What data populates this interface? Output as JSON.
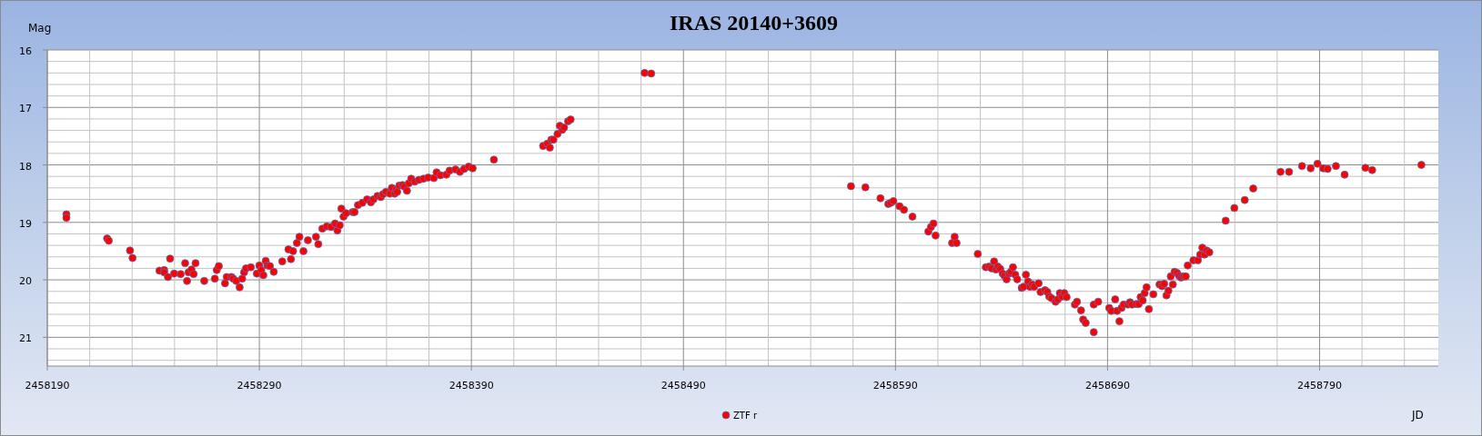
{
  "chart": {
    "chart_data": {
      "type": "scatter",
      "title": "IRAS 20140+3609",
      "xlabel": "JD",
      "ylabel": "Mag",
      "xlim": [
        2458190,
        2458846
      ],
      "ylim": [
        21.5,
        16
      ],
      "xticks": [
        2458190,
        2458290,
        2458390,
        2458490,
        2458590,
        2458690,
        2458790
      ],
      "yticks": [
        16,
        17,
        18,
        19,
        20,
        21
      ],
      "grid": true,
      "x": [
        2458199.0,
        2458199.0,
        2458218.2,
        2458219.0,
        2458229.0,
        2458230.2,
        2458242.9,
        2458245.1,
        2458245.1,
        2458246.9,
        2458247.9,
        2458249.8,
        2458252.9,
        2458255.0,
        2458255.9,
        2458256.6,
        2458258.0,
        2458259.0,
        2458259.9,
        2458264.0,
        2458269.0,
        2458269.9,
        2458270.9,
        2458273.8,
        2458274.6,
        2458276.9,
        2458277.7,
        2458279.1,
        2458280.7,
        2458281.9,
        2458282.8,
        2458283.7,
        2458286.0,
        2458288.8,
        2458290.0,
        2458290.9,
        2458291.9,
        2458293.0,
        2458293.8,
        2458295.0,
        2458296.8,
        2458300.8,
        2458303.7,
        2458304.9,
        2458305.9,
        2458307.7,
        2458308.9,
        2458310.8,
        2458312.9,
        2458316.7,
        2458317.8,
        2458319.7,
        2458321.8,
        2458323.8,
        2458325.7,
        2458326.8,
        2458327.9,
        2458328.7,
        2458329.7,
        2458330.9,
        2458334.0,
        2458334.9,
        2458336.5,
        2458338.6,
        2458340.8,
        2458342.6,
        2458343.8,
        2458345.7,
        2458347.3,
        2458348.3,
        2458349.7,
        2458351.6,
        2458352.5,
        2458353.8,
        2458354.4,
        2458355.0,
        2458356.0,
        2458357.5,
        2458358.4,
        2458359.6,
        2458360.5,
        2458361.6,
        2458363.3,
        2458365.3,
        2458367.4,
        2458369.6,
        2458372.3,
        2458373.6,
        2458375.4,
        2458378.2,
        2458379.7,
        2458382.5,
        2458384.6,
        2458386.6,
        2458388.7,
        2458390.6,
        2458400.6,
        2458423.8,
        2458425.8,
        2458427.0,
        2458427.7,
        2458428.7,
        2458430.6,
        2458431.7,
        2458432.8,
        2458433.7,
        2458435.6,
        2458436.8,
        2458471.7,
        2458474.8,
        2458569.0,
        2458575.8,
        2458582.9,
        2458586.6,
        2458587.8,
        2458589.0,
        2458591.9,
        2458594.0,
        2458598.0,
        2458605.5,
        2458606.7,
        2458607.9,
        2458608.9,
        2458616.7,
        2458617.9,
        2458618.8,
        2458628.8,
        2458632.6,
        2458634.1,
        2458635.3,
        2458636.5,
        2458637.4,
        2458638.3,
        2458639.4,
        2458640.5,
        2458641.4,
        2458642.4,
        2458643.5,
        2458644.4,
        2458645.4,
        2458646.5,
        2458647.4,
        2458649.5,
        2458650.4,
        2458651.5,
        2458652.5,
        2458653.4,
        2458654.5,
        2458655.4,
        2458657.5,
        2458658.4,
        2458660.5,
        2458661.6,
        2458662.5,
        2458663.6,
        2458665.5,
        2458666.6,
        2458667.5,
        2458668.5,
        2458669.6,
        2458670.7,
        2458674.6,
        2458675.6,
        2458677.5,
        2458678.5,
        2458679.7,
        2458683.5,
        2458683.5,
        2458685.6,
        2458690.8,
        2458691.8,
        2458693.6,
        2458694.5,
        2458695.6,
        2458696.6,
        2458697.6,
        2458699.7,
        2458700.6,
        2458701.6,
        2458703.6,
        2458704.7,
        2458705.6,
        2458706.6,
        2458707.5,
        2458708.4,
        2458709.5,
        2458711.6,
        2458714.5,
        2458715.7,
        2458716.7,
        2458717.8,
        2458718.7,
        2458719.8,
        2458720.8,
        2458721.6,
        2458722.8,
        2458723.7,
        2458724.7,
        2458725.8,
        2458726.9,
        2458727.8,
        2458730.5,
        2458732.6,
        2458733.7,
        2458734.7,
        2458735.8,
        2458736.8,
        2458738.0,
        2458745.7,
        2458749.8,
        2458754.7,
        2458758.7,
        2458771.6,
        2458775.6,
        2458781.7,
        2458785.8,
        2458789.0,
        2458791.7,
        2458793.8,
        2458797.7,
        2458801.8,
        2458811.6,
        2458814.8,
        2458838.0
      ],
      "series": [
        {
          "name": "ZTF r",
          "color": "#ff0000",
          "values": [
            18.86,
            18.92,
            19.28,
            19.32,
            19.49,
            19.62,
            19.84,
            19.83,
            19.87,
            19.95,
            19.63,
            19.89,
            19.9,
            19.71,
            20.02,
            19.87,
            19.82,
            19.9,
            19.71,
            20.02,
            19.98,
            19.83,
            19.76,
            20.06,
            19.95,
            19.95,
            19.98,
            20.02,
            20.13,
            19.98,
            19.87,
            19.8,
            19.78,
            19.89,
            19.75,
            19.83,
            19.92,
            19.67,
            19.75,
            19.76,
            19.86,
            19.68,
            19.47,
            19.64,
            19.5,
            19.36,
            19.25,
            19.5,
            19.31,
            19.25,
            19.38,
            19.11,
            19.07,
            19.08,
            19.02,
            19.14,
            19.05,
            18.76,
            18.9,
            18.84,
            18.82,
            18.82,
            18.7,
            18.66,
            18.6,
            18.65,
            18.6,
            18.54,
            18.56,
            18.51,
            18.47,
            18.5,
            18.4,
            18.5,
            18.43,
            18.47,
            18.36,
            18.35,
            18.38,
            18.45,
            18.32,
            18.24,
            18.29,
            18.26,
            18.24,
            18.22,
            18.23,
            18.13,
            18.18,
            18.17,
            18.1,
            18.08,
            18.12,
            18.07,
            18.03,
            18.06,
            17.91,
            17.67,
            17.63,
            17.7,
            17.56,
            17.56,
            17.46,
            17.32,
            17.39,
            17.35,
            17.24,
            17.21,
            16.4,
            16.41,
            18.37,
            18.39,
            18.58,
            18.68,
            18.66,
            18.63,
            18.72,
            18.78,
            18.9,
            19.16,
            19.08,
            19.02,
            19.23,
            19.36,
            19.25,
            19.36,
            19.55,
            19.78,
            19.77,
            19.8,
            19.68,
            19.82,
            19.77,
            19.81,
            19.89,
            19.93,
            19.99,
            19.89,
            19.86,
            19.78,
            19.91,
            19.99,
            20.14,
            20.12,
            19.91,
            20.03,
            20.12,
            20.08,
            20.12,
            20.06,
            20.21,
            20.18,
            20.21,
            20.29,
            20.32,
            20.38,
            20.34,
            20.23,
            20.29,
            20.23,
            20.3,
            20.43,
            20.38,
            20.53,
            20.69,
            20.75,
            20.91,
            20.43,
            20.38,
            20.49,
            20.54,
            20.34,
            20.54,
            20.72,
            20.49,
            20.43,
            20.43,
            20.39,
            20.43,
            20.42,
            20.42,
            20.3,
            20.36,
            20.23,
            20.13,
            20.51,
            20.25,
            20.08,
            20.11,
            20.07,
            20.27,
            20.19,
            19.94,
            20.08,
            19.86,
            19.88,
            19.93,
            19.96,
            19.94,
            19.94,
            19.75,
            19.66,
            19.66,
            19.56,
            19.44,
            19.56,
            19.49,
            19.52,
            18.97,
            18.75,
            18.61,
            18.41,
            18.12,
            18.12,
            18.02,
            18.06,
            17.98,
            18.06,
            18.07,
            18.02,
            18.17,
            18.05,
            18.09,
            18.0
          ]
        }
      ]
    }
  }
}
